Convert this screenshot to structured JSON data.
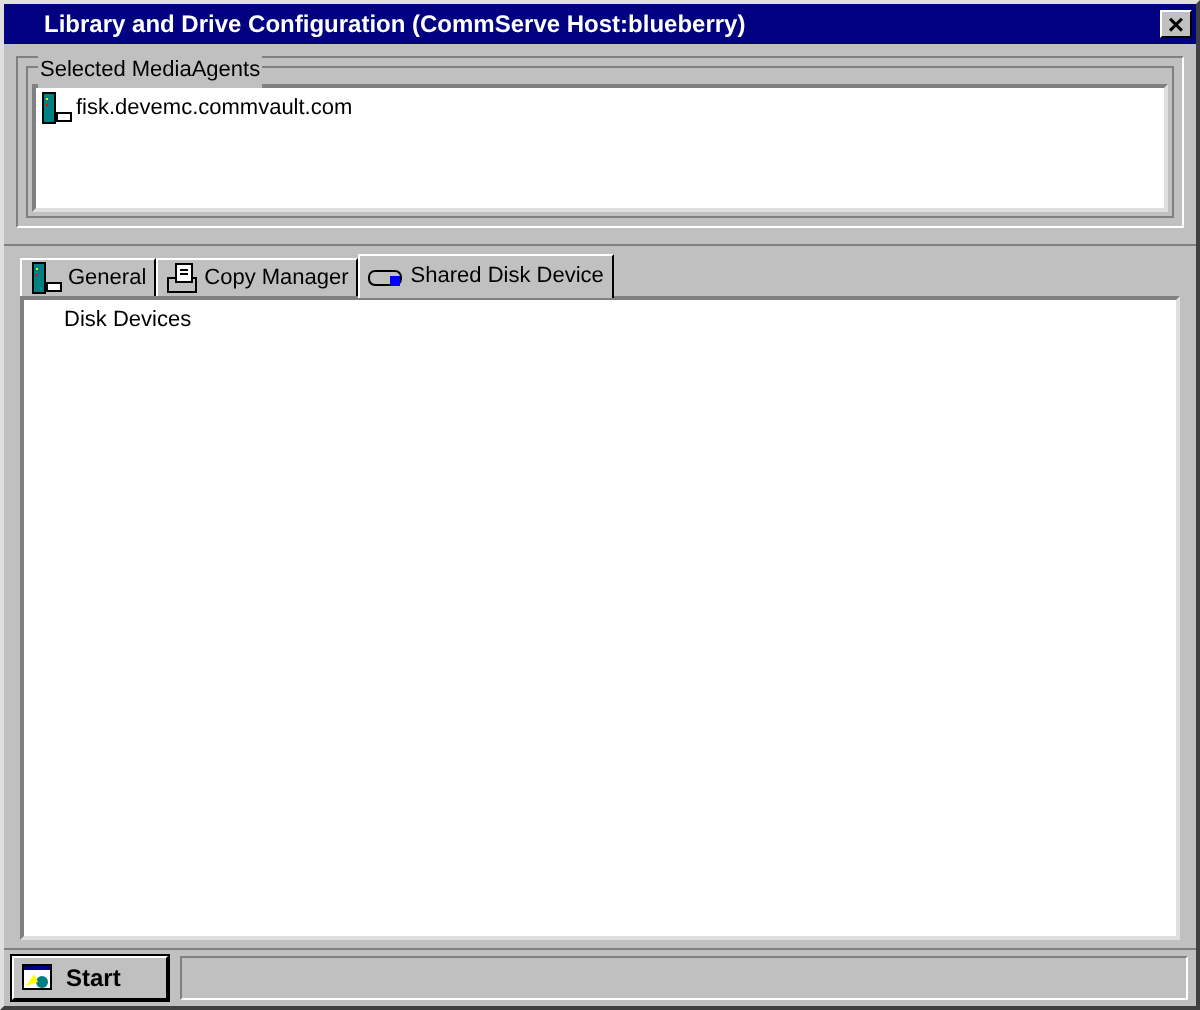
{
  "window": {
    "title": "Library and Drive Configuration (CommServe Host:blueberry)",
    "close": "×"
  },
  "media_agents": {
    "label": "Selected MediaAgents",
    "items": [
      {
        "name": "fisk.devemc.commvault.com",
        "kind": "server"
      }
    ]
  },
  "tabs": [
    {
      "label": "General",
      "kind": "server",
      "selected": false
    },
    {
      "label": "Copy Manager",
      "kind": "copy",
      "selected": false
    },
    {
      "label": "Shared Disk Device",
      "kind": "disk",
      "selected": true
    }
  ],
  "tree": [
    {
      "label": "Disk Devices"
    }
  ],
  "start_button": {
    "label": "Start"
  }
}
